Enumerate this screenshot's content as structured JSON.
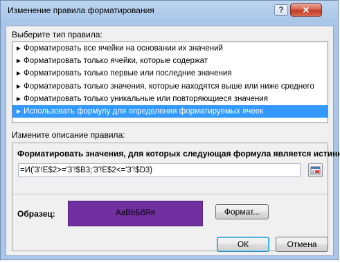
{
  "window": {
    "title": "Изменение правила форматирования"
  },
  "titlebar_buttons": {
    "help": "?",
    "close": "✕"
  },
  "rule_type": {
    "label": "Выберите тип правила:",
    "items": [
      "Форматировать все ячейки на основании их значений",
      "Форматировать только ячейки, которые содержат",
      "Форматировать только первые или последние значения",
      "Форматировать только значения, которые находятся выше или ниже среднего",
      "Форматировать только уникальные или повторяющиеся значения",
      "Использовать формулу для определения форматируемых ячеек"
    ],
    "selected_index": 5
  },
  "description": {
    "label": "Измените описание правила:",
    "formula_label": "Форматировать значения, для которых следующая формула является истинной:",
    "formula_value": "=И('3'!E$2>='3'!$B3;'3'!E$2<='3'!$D3)"
  },
  "preview": {
    "label": "Образец:",
    "sample_text": "АаВbБбЯя",
    "fill_color": "#7030a0"
  },
  "buttons": {
    "format": "Формат...",
    "ok": "ОК",
    "cancel": "Отмена"
  }
}
